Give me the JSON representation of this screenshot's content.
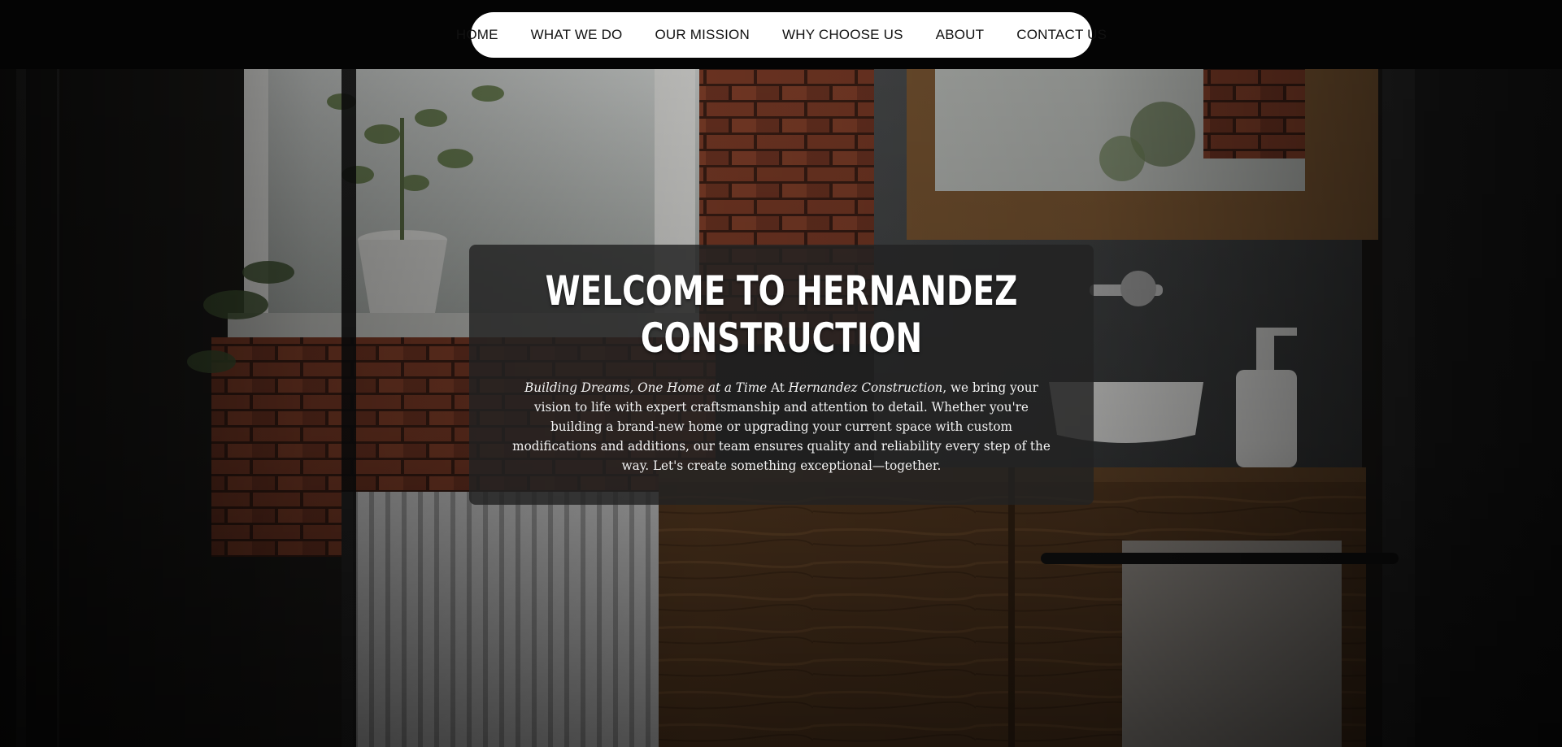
{
  "nav": {
    "items": [
      {
        "label": "HOME"
      },
      {
        "label": "WHAT WE DO"
      },
      {
        "label": "OUR MISSION"
      },
      {
        "label": "WHY CHOOSE US"
      },
      {
        "label": "ABOUT"
      },
      {
        "label": "CONTACT US"
      }
    ]
  },
  "hero": {
    "title": "WELCOME TO HERNANDEZ CONSTRUCTION",
    "tagline": "Building Dreams, One Home at a Time",
    "body_lead": " At ",
    "company_name": "Hernandez Construction",
    "body_rest": ", we bring your vision to life with expert craftsmanship and attention to detail. Whether you're building a brand-new home or upgrading your current space with custom modifications and additions, our team ensures quality and reliability every step of the way. Let's create something exceptional—together."
  },
  "colors": {
    "topbar": "#040404",
    "nav_pill": "#ffffff",
    "nav_text": "#111111",
    "card_bg": "#222222",
    "card_text": "#ffffff"
  }
}
